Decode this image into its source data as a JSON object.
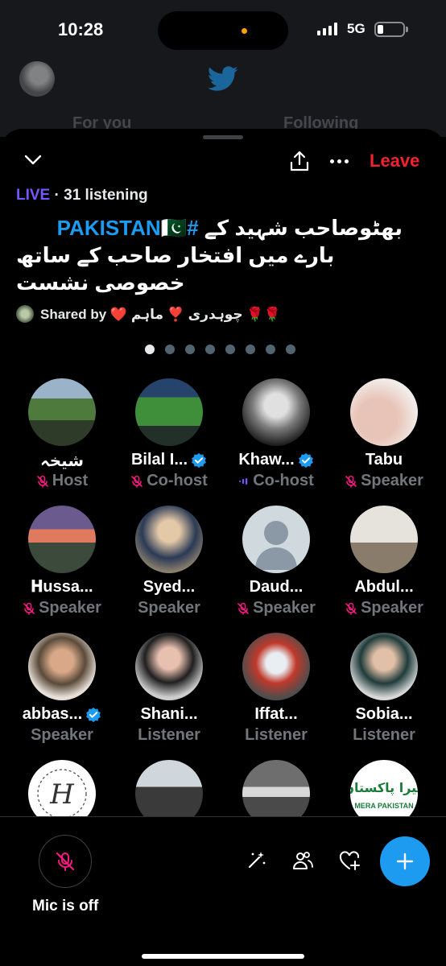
{
  "status": {
    "time": "10:28",
    "network": "5G"
  },
  "app_bg": {
    "tab_for_you": "For you",
    "tab_following": "Following"
  },
  "space": {
    "leave_label": "Leave",
    "live_label": "LIVE",
    "listening": "· 31 listening",
    "title_hashtag": "#PAKISTAN🇵🇰",
    "title_line1": "بھٹوصاحب شہید کے",
    "title_line2": "بارے میں افتخار صاحب کے ساتھ",
    "title_line3": "خصوصی نشست",
    "shared_by": "Shared by ❤️ چوہدری ❣️ ماہم 🌹🌹",
    "page_count": 8,
    "active_page": 1
  },
  "participants": [
    {
      "name": "شیخہ",
      "role": "Host",
      "verified": false,
      "mic": "muted"
    },
    {
      "name": "Bilal I...",
      "role": "Co-host",
      "verified": true,
      "mic": "muted"
    },
    {
      "name": "Khaw...",
      "role": "Co-host",
      "verified": true,
      "mic": "speaking"
    },
    {
      "name": "Tabu",
      "role": "Speaker",
      "verified": false,
      "mic": "muted"
    },
    {
      "name": "𝐇ussa...",
      "role": "Speaker",
      "verified": false,
      "mic": "muted"
    },
    {
      "name": "Syed...",
      "role": "Speaker",
      "verified": false,
      "mic": "none"
    },
    {
      "name": "Daud...",
      "role": "Speaker",
      "verified": false,
      "mic": "muted"
    },
    {
      "name": "Abdul...",
      "role": "Speaker",
      "verified": false,
      "mic": "muted"
    },
    {
      "name": "abbas...",
      "role": "Speaker",
      "verified": true,
      "mic": "none"
    },
    {
      "name": "Shani...",
      "role": "Listener",
      "verified": false,
      "mic": "none"
    },
    {
      "name": "Iffat...",
      "role": "Listener",
      "verified": false,
      "mic": "none"
    },
    {
      "name": "Sobia...",
      "role": "Listener",
      "verified": false,
      "mic": "none"
    },
    {
      "name": "",
      "role": "",
      "verified": false,
      "mic": "none"
    },
    {
      "name": "",
      "role": "",
      "verified": false,
      "mic": "none"
    },
    {
      "name": "",
      "role": "",
      "verified": false,
      "mic": "none"
    },
    {
      "name": "",
      "role": "",
      "verified": false,
      "mic": "none"
    }
  ],
  "bottom": {
    "mic_label": "Mic is off"
  },
  "avatar_logos": {
    "h_logo": "H",
    "mera_pakistan": "MERA PAKISTAN",
    "mera_urdu": "میرا پاکستان"
  },
  "colors": {
    "accent_blue": "#1d9bf0",
    "live_purple": "#7856ff",
    "leave_red": "#f4212e",
    "muted_pink": "#f91880",
    "secondary_text": "#71767b"
  }
}
